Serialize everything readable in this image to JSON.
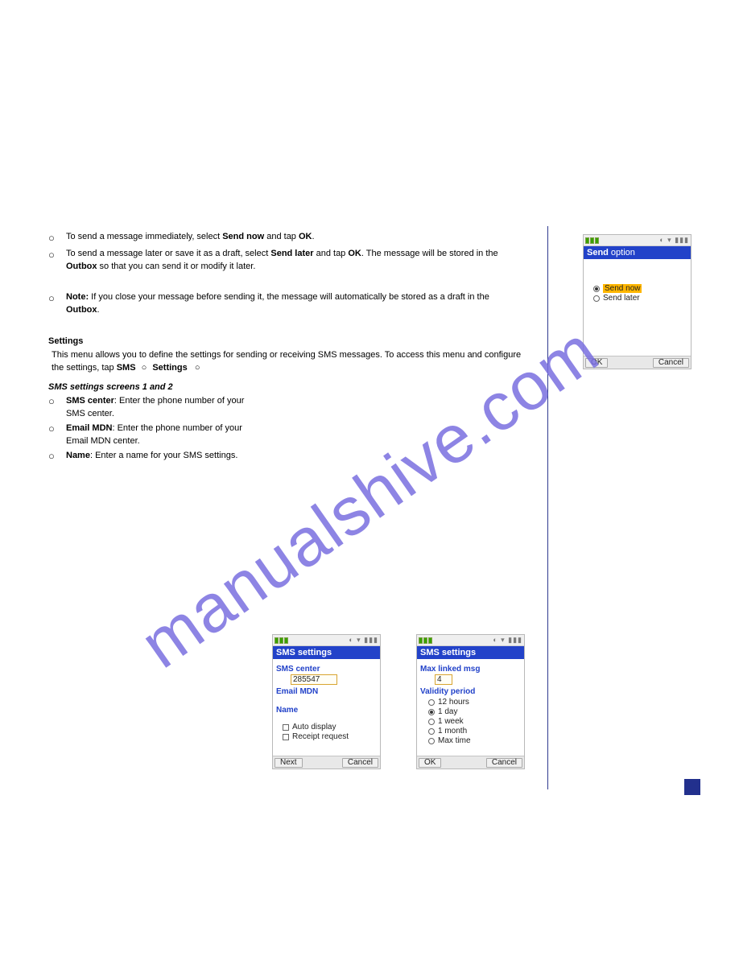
{
  "watermark": "manualshive.com",
  "left": {
    "p1a": "To send a message immediately, select ",
    "p1b": "Send now",
    "p1c": " and tap ",
    "p1d": "OK",
    "p1e": ".",
    "p2a": "To send a message later or save it as a draft, select ",
    "p2b": "Send later",
    "p2c": " and tap ",
    "p2d": "OK",
    "p2e": ". The message will be stored in the ",
    "p2f": "Outbox",
    "p2g": " so that you can send it or modify it later.",
    "noteBold": "Note:",
    "noteText": " If you close your message before sending it, the message will automatically be stored as a draft in the ",
    "noteOutbox": "Outbox",
    "noteEnd": ".",
    "settingsHead": "Settings",
    "p3a": "This menu allows you to define the settings for sending or receiving SMS messages. To access this menu and configure the settings, tap ",
    "p3b": "SMS",
    "p3c": "Settings",
    "sub": "SMS settings screens 1 and 2",
    "b1": "SMS center",
    "b1t": ": Enter the phone number of your SMS center.",
    "b2": "Email MDN",
    "b2t": ": Enter the phone number of your Email MDN center.",
    "b3": "Name",
    "b3t": ": Enter a name for your SMS settings."
  },
  "sendOption": {
    "titleBold": "Send",
    "titleLight": "option",
    "opt1": "Send now",
    "opt2": "Send later",
    "ok": "OK",
    "cancel": "Cancel"
  },
  "sms1": {
    "title": "SMS settings",
    "lbl1": "SMS center",
    "val1": "285547",
    "lbl2": "Email MDN",
    "lbl3": "Name",
    "chk1": "Auto display",
    "chk2": "Receipt request",
    "ok": "Next",
    "cancel": "Cancel"
  },
  "sms2": {
    "title": "SMS settings",
    "lbl1": "Max linked msg",
    "val1": "4",
    "lbl2": "Validity period",
    "r1": "12 hours",
    "r2": "1 day",
    "r3": "1 week",
    "r4": "1 month",
    "r5": "Max time",
    "ok": "OK",
    "cancel": "Cancel"
  }
}
